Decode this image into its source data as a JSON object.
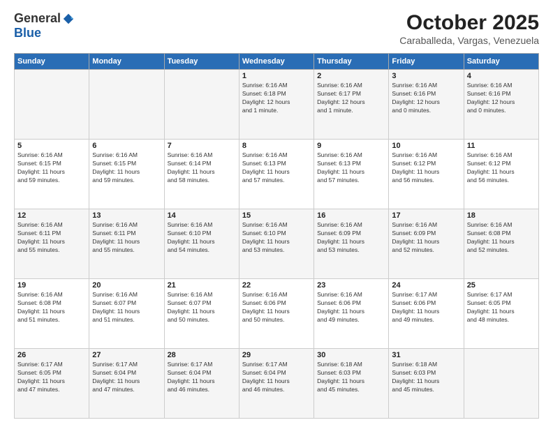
{
  "header": {
    "logo_general": "General",
    "logo_blue": "Blue",
    "month_title": "October 2025",
    "location": "Caraballeda, Vargas, Venezuela"
  },
  "weekdays": [
    "Sunday",
    "Monday",
    "Tuesday",
    "Wednesday",
    "Thursday",
    "Friday",
    "Saturday"
  ],
  "weeks": [
    [
      {
        "day": "",
        "info": ""
      },
      {
        "day": "",
        "info": ""
      },
      {
        "day": "",
        "info": ""
      },
      {
        "day": "1",
        "info": "Sunrise: 6:16 AM\nSunset: 6:18 PM\nDaylight: 12 hours\nand 1 minute."
      },
      {
        "day": "2",
        "info": "Sunrise: 6:16 AM\nSunset: 6:17 PM\nDaylight: 12 hours\nand 1 minute."
      },
      {
        "day": "3",
        "info": "Sunrise: 6:16 AM\nSunset: 6:16 PM\nDaylight: 12 hours\nand 0 minutes."
      },
      {
        "day": "4",
        "info": "Sunrise: 6:16 AM\nSunset: 6:16 PM\nDaylight: 12 hours\nand 0 minutes."
      }
    ],
    [
      {
        "day": "5",
        "info": "Sunrise: 6:16 AM\nSunset: 6:15 PM\nDaylight: 11 hours\nand 59 minutes."
      },
      {
        "day": "6",
        "info": "Sunrise: 6:16 AM\nSunset: 6:15 PM\nDaylight: 11 hours\nand 59 minutes."
      },
      {
        "day": "7",
        "info": "Sunrise: 6:16 AM\nSunset: 6:14 PM\nDaylight: 11 hours\nand 58 minutes."
      },
      {
        "day": "8",
        "info": "Sunrise: 6:16 AM\nSunset: 6:13 PM\nDaylight: 11 hours\nand 57 minutes."
      },
      {
        "day": "9",
        "info": "Sunrise: 6:16 AM\nSunset: 6:13 PM\nDaylight: 11 hours\nand 57 minutes."
      },
      {
        "day": "10",
        "info": "Sunrise: 6:16 AM\nSunset: 6:12 PM\nDaylight: 11 hours\nand 56 minutes."
      },
      {
        "day": "11",
        "info": "Sunrise: 6:16 AM\nSunset: 6:12 PM\nDaylight: 11 hours\nand 56 minutes."
      }
    ],
    [
      {
        "day": "12",
        "info": "Sunrise: 6:16 AM\nSunset: 6:11 PM\nDaylight: 11 hours\nand 55 minutes."
      },
      {
        "day": "13",
        "info": "Sunrise: 6:16 AM\nSunset: 6:11 PM\nDaylight: 11 hours\nand 55 minutes."
      },
      {
        "day": "14",
        "info": "Sunrise: 6:16 AM\nSunset: 6:10 PM\nDaylight: 11 hours\nand 54 minutes."
      },
      {
        "day": "15",
        "info": "Sunrise: 6:16 AM\nSunset: 6:10 PM\nDaylight: 11 hours\nand 53 minutes."
      },
      {
        "day": "16",
        "info": "Sunrise: 6:16 AM\nSunset: 6:09 PM\nDaylight: 11 hours\nand 53 minutes."
      },
      {
        "day": "17",
        "info": "Sunrise: 6:16 AM\nSunset: 6:09 PM\nDaylight: 11 hours\nand 52 minutes."
      },
      {
        "day": "18",
        "info": "Sunrise: 6:16 AM\nSunset: 6:08 PM\nDaylight: 11 hours\nand 52 minutes."
      }
    ],
    [
      {
        "day": "19",
        "info": "Sunrise: 6:16 AM\nSunset: 6:08 PM\nDaylight: 11 hours\nand 51 minutes."
      },
      {
        "day": "20",
        "info": "Sunrise: 6:16 AM\nSunset: 6:07 PM\nDaylight: 11 hours\nand 51 minutes."
      },
      {
        "day": "21",
        "info": "Sunrise: 6:16 AM\nSunset: 6:07 PM\nDaylight: 11 hours\nand 50 minutes."
      },
      {
        "day": "22",
        "info": "Sunrise: 6:16 AM\nSunset: 6:06 PM\nDaylight: 11 hours\nand 50 minutes."
      },
      {
        "day": "23",
        "info": "Sunrise: 6:16 AM\nSunset: 6:06 PM\nDaylight: 11 hours\nand 49 minutes."
      },
      {
        "day": "24",
        "info": "Sunrise: 6:17 AM\nSunset: 6:06 PM\nDaylight: 11 hours\nand 49 minutes."
      },
      {
        "day": "25",
        "info": "Sunrise: 6:17 AM\nSunset: 6:05 PM\nDaylight: 11 hours\nand 48 minutes."
      }
    ],
    [
      {
        "day": "26",
        "info": "Sunrise: 6:17 AM\nSunset: 6:05 PM\nDaylight: 11 hours\nand 47 minutes."
      },
      {
        "day": "27",
        "info": "Sunrise: 6:17 AM\nSunset: 6:04 PM\nDaylight: 11 hours\nand 47 minutes."
      },
      {
        "day": "28",
        "info": "Sunrise: 6:17 AM\nSunset: 6:04 PM\nDaylight: 11 hours\nand 46 minutes."
      },
      {
        "day": "29",
        "info": "Sunrise: 6:17 AM\nSunset: 6:04 PM\nDaylight: 11 hours\nand 46 minutes."
      },
      {
        "day": "30",
        "info": "Sunrise: 6:18 AM\nSunset: 6:03 PM\nDaylight: 11 hours\nand 45 minutes."
      },
      {
        "day": "31",
        "info": "Sunrise: 6:18 AM\nSunset: 6:03 PM\nDaylight: 11 hours\nand 45 minutes."
      },
      {
        "day": "",
        "info": ""
      }
    ]
  ]
}
